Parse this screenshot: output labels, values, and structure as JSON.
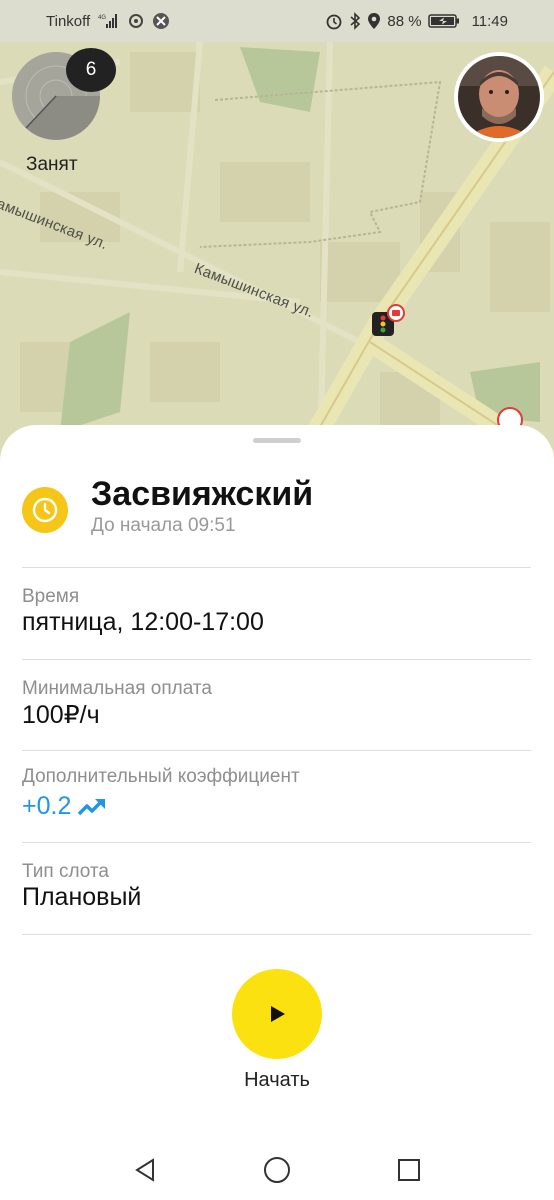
{
  "status_bar": {
    "carrier": "Tinkoff",
    "network": "4G",
    "battery": "88 %",
    "time": "11:49",
    "icons": [
      "signal-icon",
      "sync-icon",
      "vpn-icon",
      "alarm-icon",
      "bluetooth-icon",
      "location-icon",
      "battery-icon"
    ]
  },
  "map": {
    "streets": [
      "Камышинская ул.",
      "Камышинская ул."
    ],
    "busy_count": "6",
    "busy_label": "Занят",
    "colors": {
      "land": "#dcdbb8",
      "road": "#e9e6b4",
      "park": "#b7c79a"
    }
  },
  "slot": {
    "zone": "Засвияжский",
    "countdown": "До начала 09:51",
    "time_label": "Время",
    "time_value": "пятница, 12:00-17:00",
    "min_pay_label": "Минимальная оплата",
    "min_pay_value": "100₽/ч",
    "coef_label": "Дополнительный коэффициент",
    "coef_value": "+0.2",
    "type_label": "Тип слота",
    "type_value": "Плановый"
  },
  "actions": {
    "start_label": "Начать"
  },
  "colors": {
    "accent_yellow": "#fbe10f",
    "zone_icon": "#f5c518",
    "coef_blue": "#2196e3"
  }
}
